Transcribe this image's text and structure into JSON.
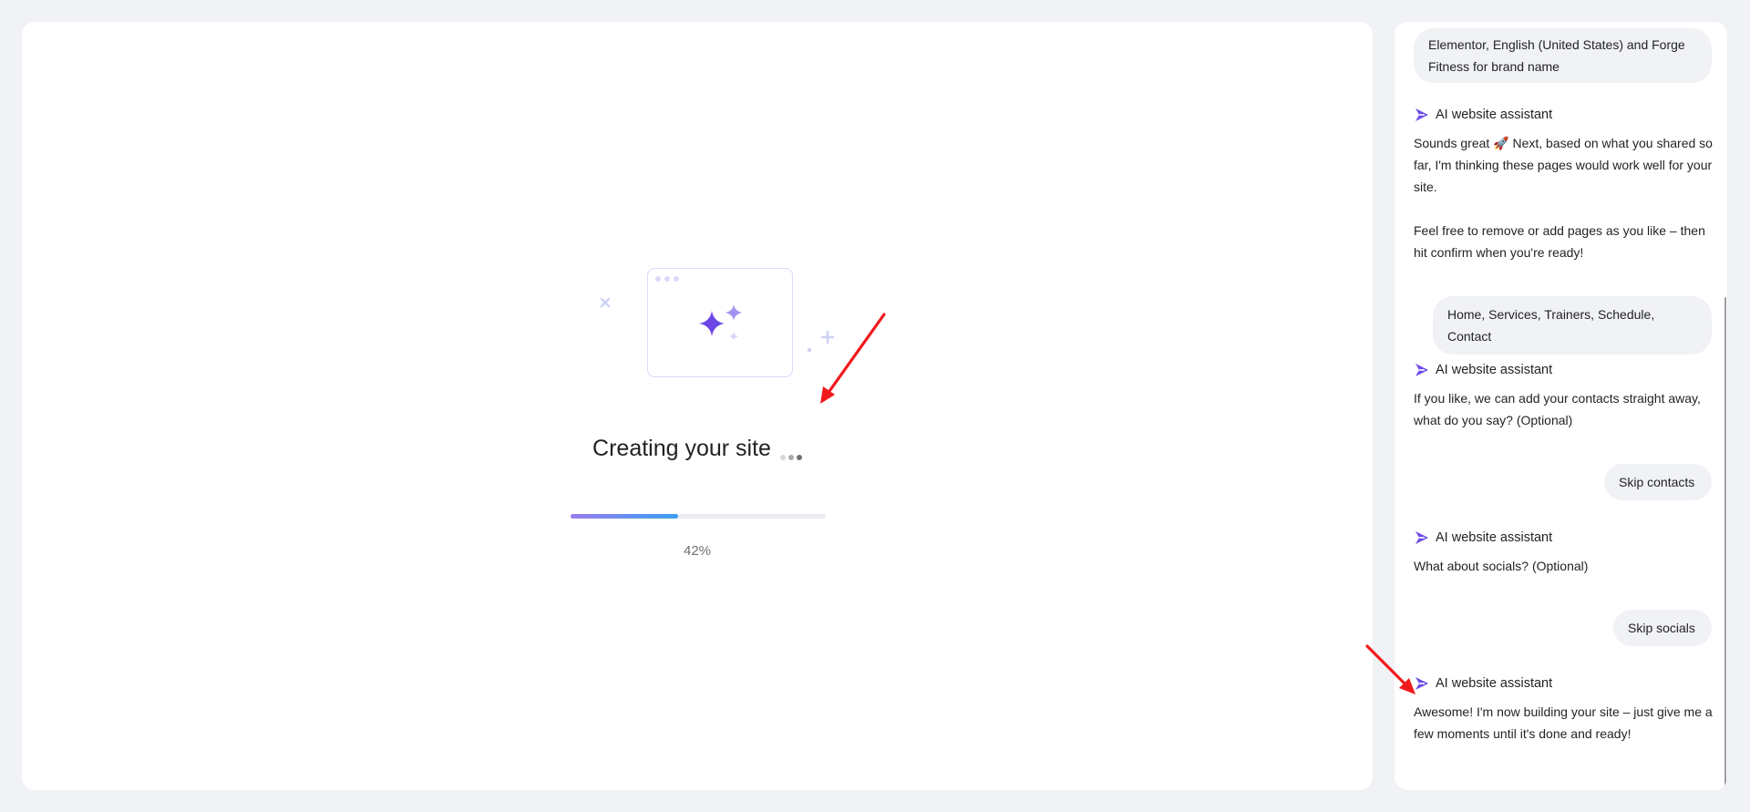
{
  "main": {
    "title": "Creating your site",
    "progress_text": "42%",
    "progress_fraction": 0.42
  },
  "chat": {
    "messages": [
      {
        "role": "user",
        "text": "Elementor, English (United States) and Forge Fitness for brand name"
      },
      {
        "role": "assistant",
        "name": "AI website assistant",
        "paragraphs": [
          "Sounds great 🚀 Next, based on what you shared so far, I'm thinking these pages would work well for your site.",
          "Feel free to remove or add pages as you like – then hit confirm when you're ready!"
        ]
      },
      {
        "role": "user",
        "text": "Home, Services, Trainers, Schedule, Contact"
      },
      {
        "role": "assistant",
        "name": "AI website assistant",
        "paragraphs": [
          "If you like, we can add your contacts straight away, what do you say? (Optional)"
        ]
      },
      {
        "role": "user",
        "text": "Skip contacts"
      },
      {
        "role": "assistant",
        "name": "AI website assistant",
        "paragraphs": [
          "What about socials? (Optional)"
        ]
      },
      {
        "role": "user",
        "text": "Skip socials"
      },
      {
        "role": "assistant",
        "name": "AI website assistant",
        "paragraphs": [
          "Awesome! I'm now building your site – just give me a few moments until it's done and ready!"
        ]
      }
    ]
  },
  "colors": {
    "accent": "#6f4be8",
    "annotation_arrow": "#f0191c"
  },
  "icons": {
    "assistant": "sparkle-icon",
    "illustration": "sparkles-icon"
  }
}
